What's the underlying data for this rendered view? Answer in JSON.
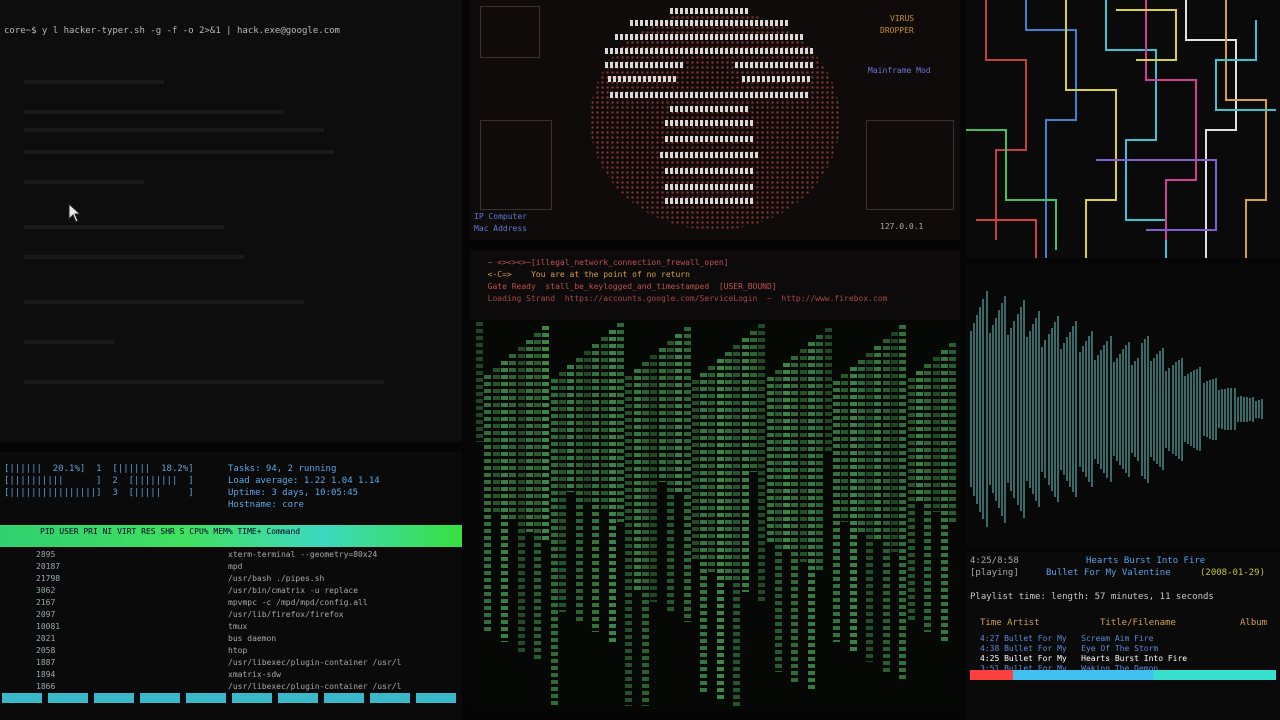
{
  "terminal": {
    "command": "core~$ y l hacker-typer.sh -g -f -o 2>&1 | hack.exe@google.com"
  },
  "htop": {
    "meters": [
      "[||||||  20.1%]  1  [||||||  18.2%]",
      "[||||||||||      ]  2  [||||||||  ]",
      "[||||||||||||||||]  3  [|||||     ]"
    ],
    "info": [
      "Tasks: 94, 2 running",
      "Load average: 1.22 1.04 1.14",
      "Uptime: 3 days, 10:05:45",
      "Hostname: core"
    ],
    "header": "PID USER PRI NI VIRT RES SHR S CPU% MEM% TIME+ Command",
    "processes": [
      {
        "pid": "2895",
        "cmd": "xterm-terminal --geometry=80x24"
      },
      {
        "pid": "20187",
        "cmd": "mpd"
      },
      {
        "pid": "21798",
        "cmd": "/usr/bash ./pipes.sh"
      },
      {
        "pid": "3062",
        "cmd": "/usr/bin/cmatrix -u replace"
      },
      {
        "pid": "2167",
        "cmd": "mpvmpc -c /mpd/mpd/config.all"
      },
      {
        "pid": "2097",
        "cmd": "/usr/lib/firefox/firefox"
      },
      {
        "pid": "10081",
        "cmd": "tmux"
      },
      {
        "pid": "2021",
        "cmd": "bus daemon"
      },
      {
        "pid": "2058",
        "cmd": "htop"
      },
      {
        "pid": "1887",
        "cmd": "/usr/libexec/plugin-container /usr/l"
      },
      {
        "pid": "1894",
        "cmd": "xmatrix-sdw"
      },
      {
        "pid": "1866",
        "cmd": "/usr/libexec/plugin-container /usr/l"
      }
    ]
  },
  "skull": {
    "labels": {
      "virus": "VIRUS",
      "dropper": "DROPPER",
      "target": "Mainframe Mod",
      "computer": "IP Computer",
      "mac": "Mac Address",
      "ip": "127.0.0.1"
    }
  },
  "status": {
    "lines": [
      "  ~ <><><>~[illegal_network_connection_frewall_open]",
      "  <-C=>    You are at the point of no return",
      "  Gate Ready  stall_be_keylogged_and_timestamped  [USER_BOUND]",
      "  Loading Strand  https://accounts.google.com/ServiceLogin  ~  http://www.firebox.com"
    ]
  },
  "music": {
    "time": "4:25/8:58",
    "state": "[playing]",
    "title": "Hearts Burst Into Fire",
    "artist": "Bullet For My Valentine",
    "date": "(2008-01-29)",
    "playlist": "Playlist time: length: 57 minutes, 11 seconds",
    "columns": [
      "Time Artist",
      "Title/Filename",
      "Album"
    ],
    "tracks": [
      {
        "time": "4:27",
        "artist": "Bullet For My",
        "title": "Scream Aim Fire"
      },
      {
        "time": "4:38",
        "artist": "Bullet For My",
        "title": "Eye Of The Storm"
      },
      {
        "time": "4:25",
        "artist": "Bullet For My",
        "title": "Hearts Burst Into Fire"
      },
      {
        "time": "3:51",
        "artist": "Bullet For My",
        "title": "Waking The Demon"
      }
    ]
  },
  "colors": {
    "htop_header": "#40e060",
    "matrix_green": "#3f8f4a",
    "progress_red": "#ff4040",
    "progress_cyan": "#40c0f0"
  }
}
